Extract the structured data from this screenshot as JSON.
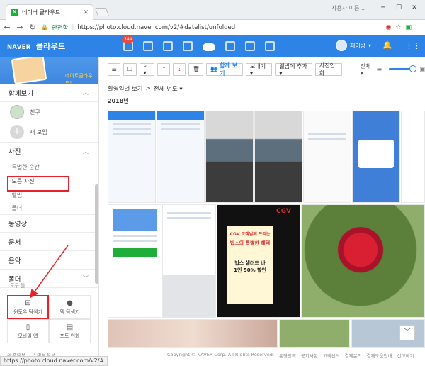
{
  "browser": {
    "tab_title": "네이버 클라우드",
    "tab_favicon": "N",
    "user_name": "사용자 이름 1",
    "secure_label": "안전함",
    "url": "https://photo.cloud.naver.com/v2/#datelist/unfolded"
  },
  "header": {
    "logo_brand": "NAVER",
    "logo_service": "클라우드",
    "badge_count": "344",
    "user_label": "페이방"
  },
  "sidebar": {
    "promo_text": "데이트클라우드!",
    "together_label": "함께보기",
    "friend_label": "친구",
    "new_group_label": "새 모임",
    "photos_label": "사진",
    "photo_items": [
      "특별한 순간",
      "모든 사진",
      "앨범",
      "폴더"
    ],
    "video_label": "동영상",
    "docs_label": "문서",
    "music_label": "음악",
    "folder_label": "폴더",
    "tools_label": "도구 툴",
    "tools": [
      {
        "label": "윈도우 탐색기",
        "icon": "windows-icon"
      },
      {
        "label": "맥 탐색기",
        "icon": "apple-icon"
      },
      {
        "label": "모바일 앱",
        "icon": "mobile-icon"
      },
      {
        "label": "포토 인화",
        "icon": "print-icon"
      }
    ],
    "footer_links": [
      "환경설정",
      "스마트설정"
    ]
  },
  "toolbar": {
    "upload_together": "함께 보기",
    "view_label": "보내기 ▾",
    "album_add": "앨범에 추가 ▾",
    "photo_print": "사진인화",
    "sort_label": "전체 ▾"
  },
  "breadcrumb": {
    "view": "촬영일별 보기",
    "separator": ">",
    "scope": "전체 년도 ▾"
  },
  "year_label": "2018년",
  "photos": [
    {
      "label": "screenshot-1"
    },
    {
      "label": "screenshot-2"
    },
    {
      "label": "sea-1"
    },
    {
      "label": "sea-2"
    },
    {
      "label": "screenshot-3"
    },
    {
      "label": "screenshot-4"
    },
    {
      "label": "screenshot-5"
    },
    {
      "label": "naver-cloud-app"
    },
    {
      "label": "keyboard-screenshot"
    },
    {
      "label": "cgv-poster"
    },
    {
      "label": "red-flower"
    }
  ],
  "cgv": {
    "brand": "CGV",
    "line1": "CGV 고객님께 드리는",
    "line2": "빕스의 특별한 혜택",
    "line3": "빕스 샐러드 바",
    "line4": "1인 50% 할인"
  },
  "footer": {
    "copyright": "Copyright © NAVER Corp. All Rights Reserved.",
    "links": [
      "운영정책",
      "공지사항",
      "고객센터",
      "결제문의",
      "결제도움안내",
      "신고하기"
    ]
  },
  "statusbar": "https://photo.cloud.naver.com/v2/#"
}
